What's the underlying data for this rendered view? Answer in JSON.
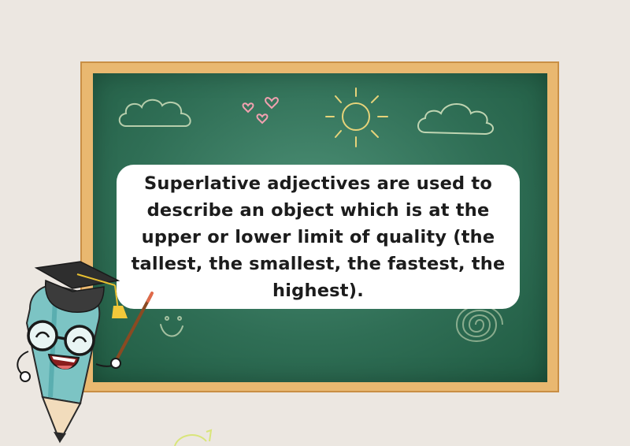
{
  "board": {
    "text": "Superlative adjectives are used to describe an object which is at the upper or lower limit of quality (the tallest, the smallest, the fastest, the highest)."
  },
  "colors": {
    "background": "#ece7e1",
    "frame": "#e9b870",
    "chalkboard": "#2f6e55",
    "chalk": "#d8e6c2",
    "heart": "#f2a1b0",
    "sun": "#e6d37a",
    "pencil_body": "#7cc4c4"
  },
  "icons": [
    "cloud-icon",
    "heart-icon",
    "sun-icon",
    "spiral-icon",
    "smiley-icon",
    "pencil-teacher-icon",
    "graduation-cap-icon"
  ]
}
